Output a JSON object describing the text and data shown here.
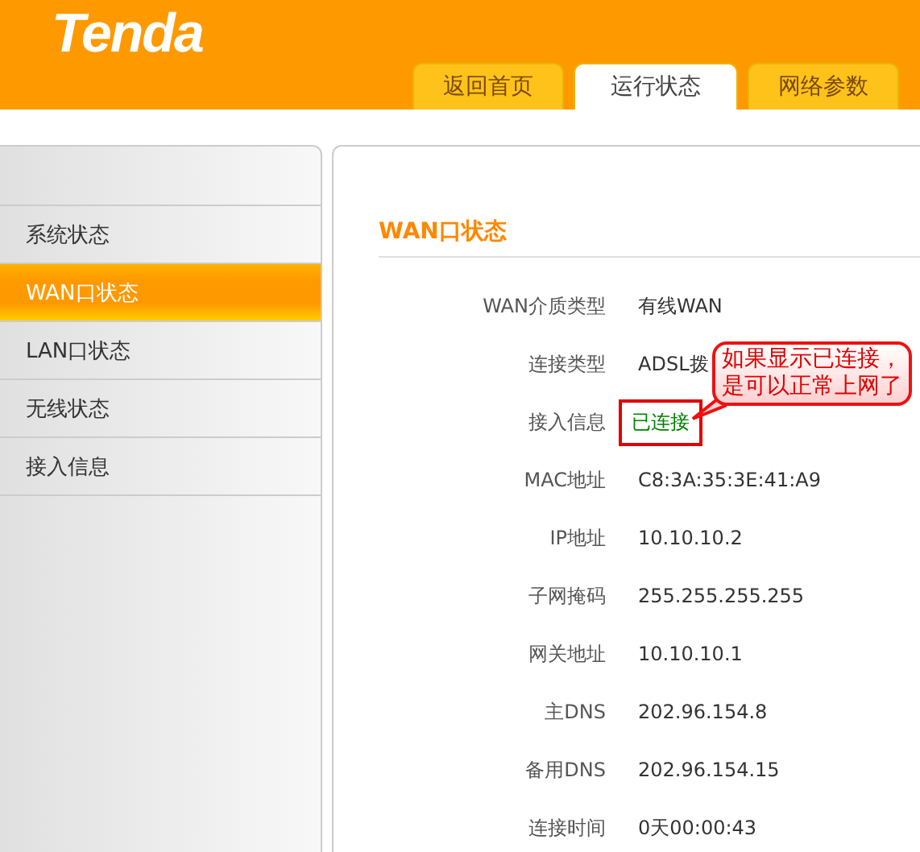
{
  "header": {
    "logo": "Tenda"
  },
  "tabs": [
    {
      "label": "返回首页",
      "selected": false
    },
    {
      "label": "运行状态",
      "selected": true
    },
    {
      "label": "网络参数",
      "selected": false
    }
  ],
  "sidebar": {
    "items": [
      {
        "label": "系统状态",
        "selected": false
      },
      {
        "label": "WAN口状态",
        "selected": true
      },
      {
        "label": "LAN口状态",
        "selected": false
      },
      {
        "label": "无线状态",
        "selected": false
      },
      {
        "label": "接入信息",
        "selected": false
      }
    ]
  },
  "panel": {
    "title": "WAN口状态",
    "rows": [
      {
        "label": "WAN介质类型",
        "value": "有线WAN",
        "kind": "plain",
        "highlighted": false
      },
      {
        "label": "连接类型",
        "value": "ADSL拨",
        "kind": "plain",
        "highlighted": false
      },
      {
        "label": "接入信息",
        "value": "已连接",
        "kind": "status",
        "highlighted": true
      },
      {
        "label": "MAC地址",
        "value": "C8:3A:35:3E:41:A9",
        "kind": "plain",
        "highlighted": false
      },
      {
        "label": "IP地址",
        "value": "10.10.10.2",
        "kind": "plain",
        "highlighted": false
      },
      {
        "label": "子网掩码",
        "value": "255.255.255.255",
        "kind": "plain",
        "highlighted": false
      },
      {
        "label": "网关地址",
        "value": "10.10.10.1",
        "kind": "plain",
        "highlighted": false
      },
      {
        "label": "主DNS",
        "value": "202.96.154.8",
        "kind": "plain",
        "highlighted": false
      },
      {
        "label": "备用DNS",
        "value": "202.96.154.15",
        "kind": "plain",
        "highlighted": false
      },
      {
        "label": "连接时间",
        "value": "0天00:00:43",
        "kind": "plain",
        "highlighted": false
      }
    ]
  },
  "annotation": {
    "lines": [
      "如果显示已连接，",
      "是可以正常上网了"
    ]
  }
}
